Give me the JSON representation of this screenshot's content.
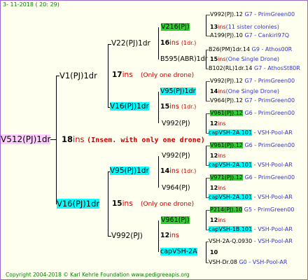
{
  "header": "3- 11-2018 ( 20: 29)",
  "footer": "Copyright 2004-2018 © Karl Kehrle Foundation   www.pedigreeapis.org",
  "root": {
    "id": "V512(PJ)1dr",
    "count": "18",
    "ins": "ins",
    "note": "(Insem. with only one drone)"
  },
  "sire": {
    "id": "V1(PJ)1dr",
    "count": "17",
    "ins": "ins",
    "note": "(Only one drone)"
  },
  "dam": {
    "id": "V16(PJ)1dr",
    "count": "15",
    "ins": "ins",
    "note": "(Only one drone)"
  },
  "g3": [
    {
      "id": "V22(PJ)1dr",
      "count": "16",
      "ins": "ins",
      "note": "(1dr.)"
    },
    {
      "id": "V16(PJ)1dr",
      "count": "15",
      "ins": "ins",
      "note": "(1dr.)"
    },
    {
      "id": "V95(PJ)1dr",
      "count": "14",
      "ins": "ins",
      "note": "(1dr.)"
    },
    {
      "id": "V992(PJ)",
      "count": "12",
      "ins": "ins",
      "note": ""
    }
  ],
  "g4": [
    {
      "id": "V216(PJ)",
      "count": "13",
      "ins": "ins",
      "note": "(11 sister colonies)"
    },
    {
      "id": "B595(ABR)1dr",
      "count": "15",
      "ins": "ins",
      "note": "(One Single Drone)"
    },
    {
      "id": "V95(PJ)1dr",
      "count": "14",
      "ins": "ins",
      "note": "(One Single Drone)"
    },
    {
      "id": "V992(PJ)",
      "count": "12",
      "ins": "ins",
      "note": ""
    },
    {
      "id": "V992(PJ)",
      "count": "12",
      "ins": "ins",
      "note": ""
    },
    {
      "id": "V964(PJ)",
      "count": "12",
      "ins": "ins",
      "note": ""
    },
    {
      "id": "V961(PJ)",
      "count": "12",
      "ins": "ins",
      "note": ""
    },
    {
      "id": "capVSH-2A",
      "count": "10",
      "ins": "",
      "note": ""
    }
  ],
  "g5": [
    {
      "id": "V992(PJ).12",
      "tail": "G7 - PrimGreen00"
    },
    {
      "id": "A199(PJ).10",
      "tail": "G7 - Cankiri97Q"
    },
    {
      "id": "B26(PM)1dr.14",
      "tail": "G9 - Athos00R"
    },
    {
      "id": "B102(RL)1dr.14",
      "tail": "G7 - AthosSt80R"
    },
    {
      "id": "V992(PJ).12",
      "tail": "G7 - PrimGreen00"
    },
    {
      "id": "V964(PJ).12",
      "tail": "G7 - PrimGreen00"
    },
    {
      "id": "V961(PJ).12",
      "tail": "G6 - PrimGreen00"
    },
    {
      "id": "capVSH-2A.101",
      "tail": "- VSH-Pool-AR"
    },
    {
      "id": "V961(PJ).12",
      "tail": "G6 - PrimGreen00"
    },
    {
      "id": "capVSH-2A.101",
      "tail": "- VSH-Pool-AR"
    },
    {
      "id": "V971(PJ).12",
      "tail": "G6 - PrimGreen00"
    },
    {
      "id": "capVSH-2A.101",
      "tail": "- VSH-Pool-AR"
    },
    {
      "id": "P214(PJ).10",
      "tail": "G5 - PrimGreen00"
    },
    {
      "id": "capVSH-1B.101",
      "tail": "- VSH-Pool-AR"
    },
    {
      "id": "VSH-2A-Q.0930",
      "tail": "- VSH-Pool-AR"
    },
    {
      "id": "VSH-Dr.08",
      "tail": "G0 - VSH-Pool-AR"
    }
  ]
}
